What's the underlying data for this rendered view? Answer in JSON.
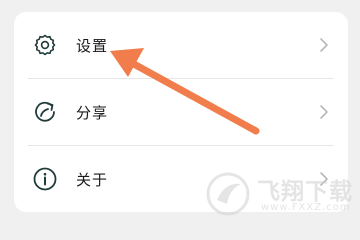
{
  "menu": {
    "items": [
      {
        "label": "设置",
        "icon": "gear-icon"
      },
      {
        "label": "分享",
        "icon": "share-icon"
      },
      {
        "label": "关于",
        "icon": "info-icon"
      }
    ]
  },
  "annotation": {
    "arrow_color": "#f07d4b"
  },
  "watermark": {
    "title": "飞翔下载",
    "url": "www.FXXZ.com"
  }
}
